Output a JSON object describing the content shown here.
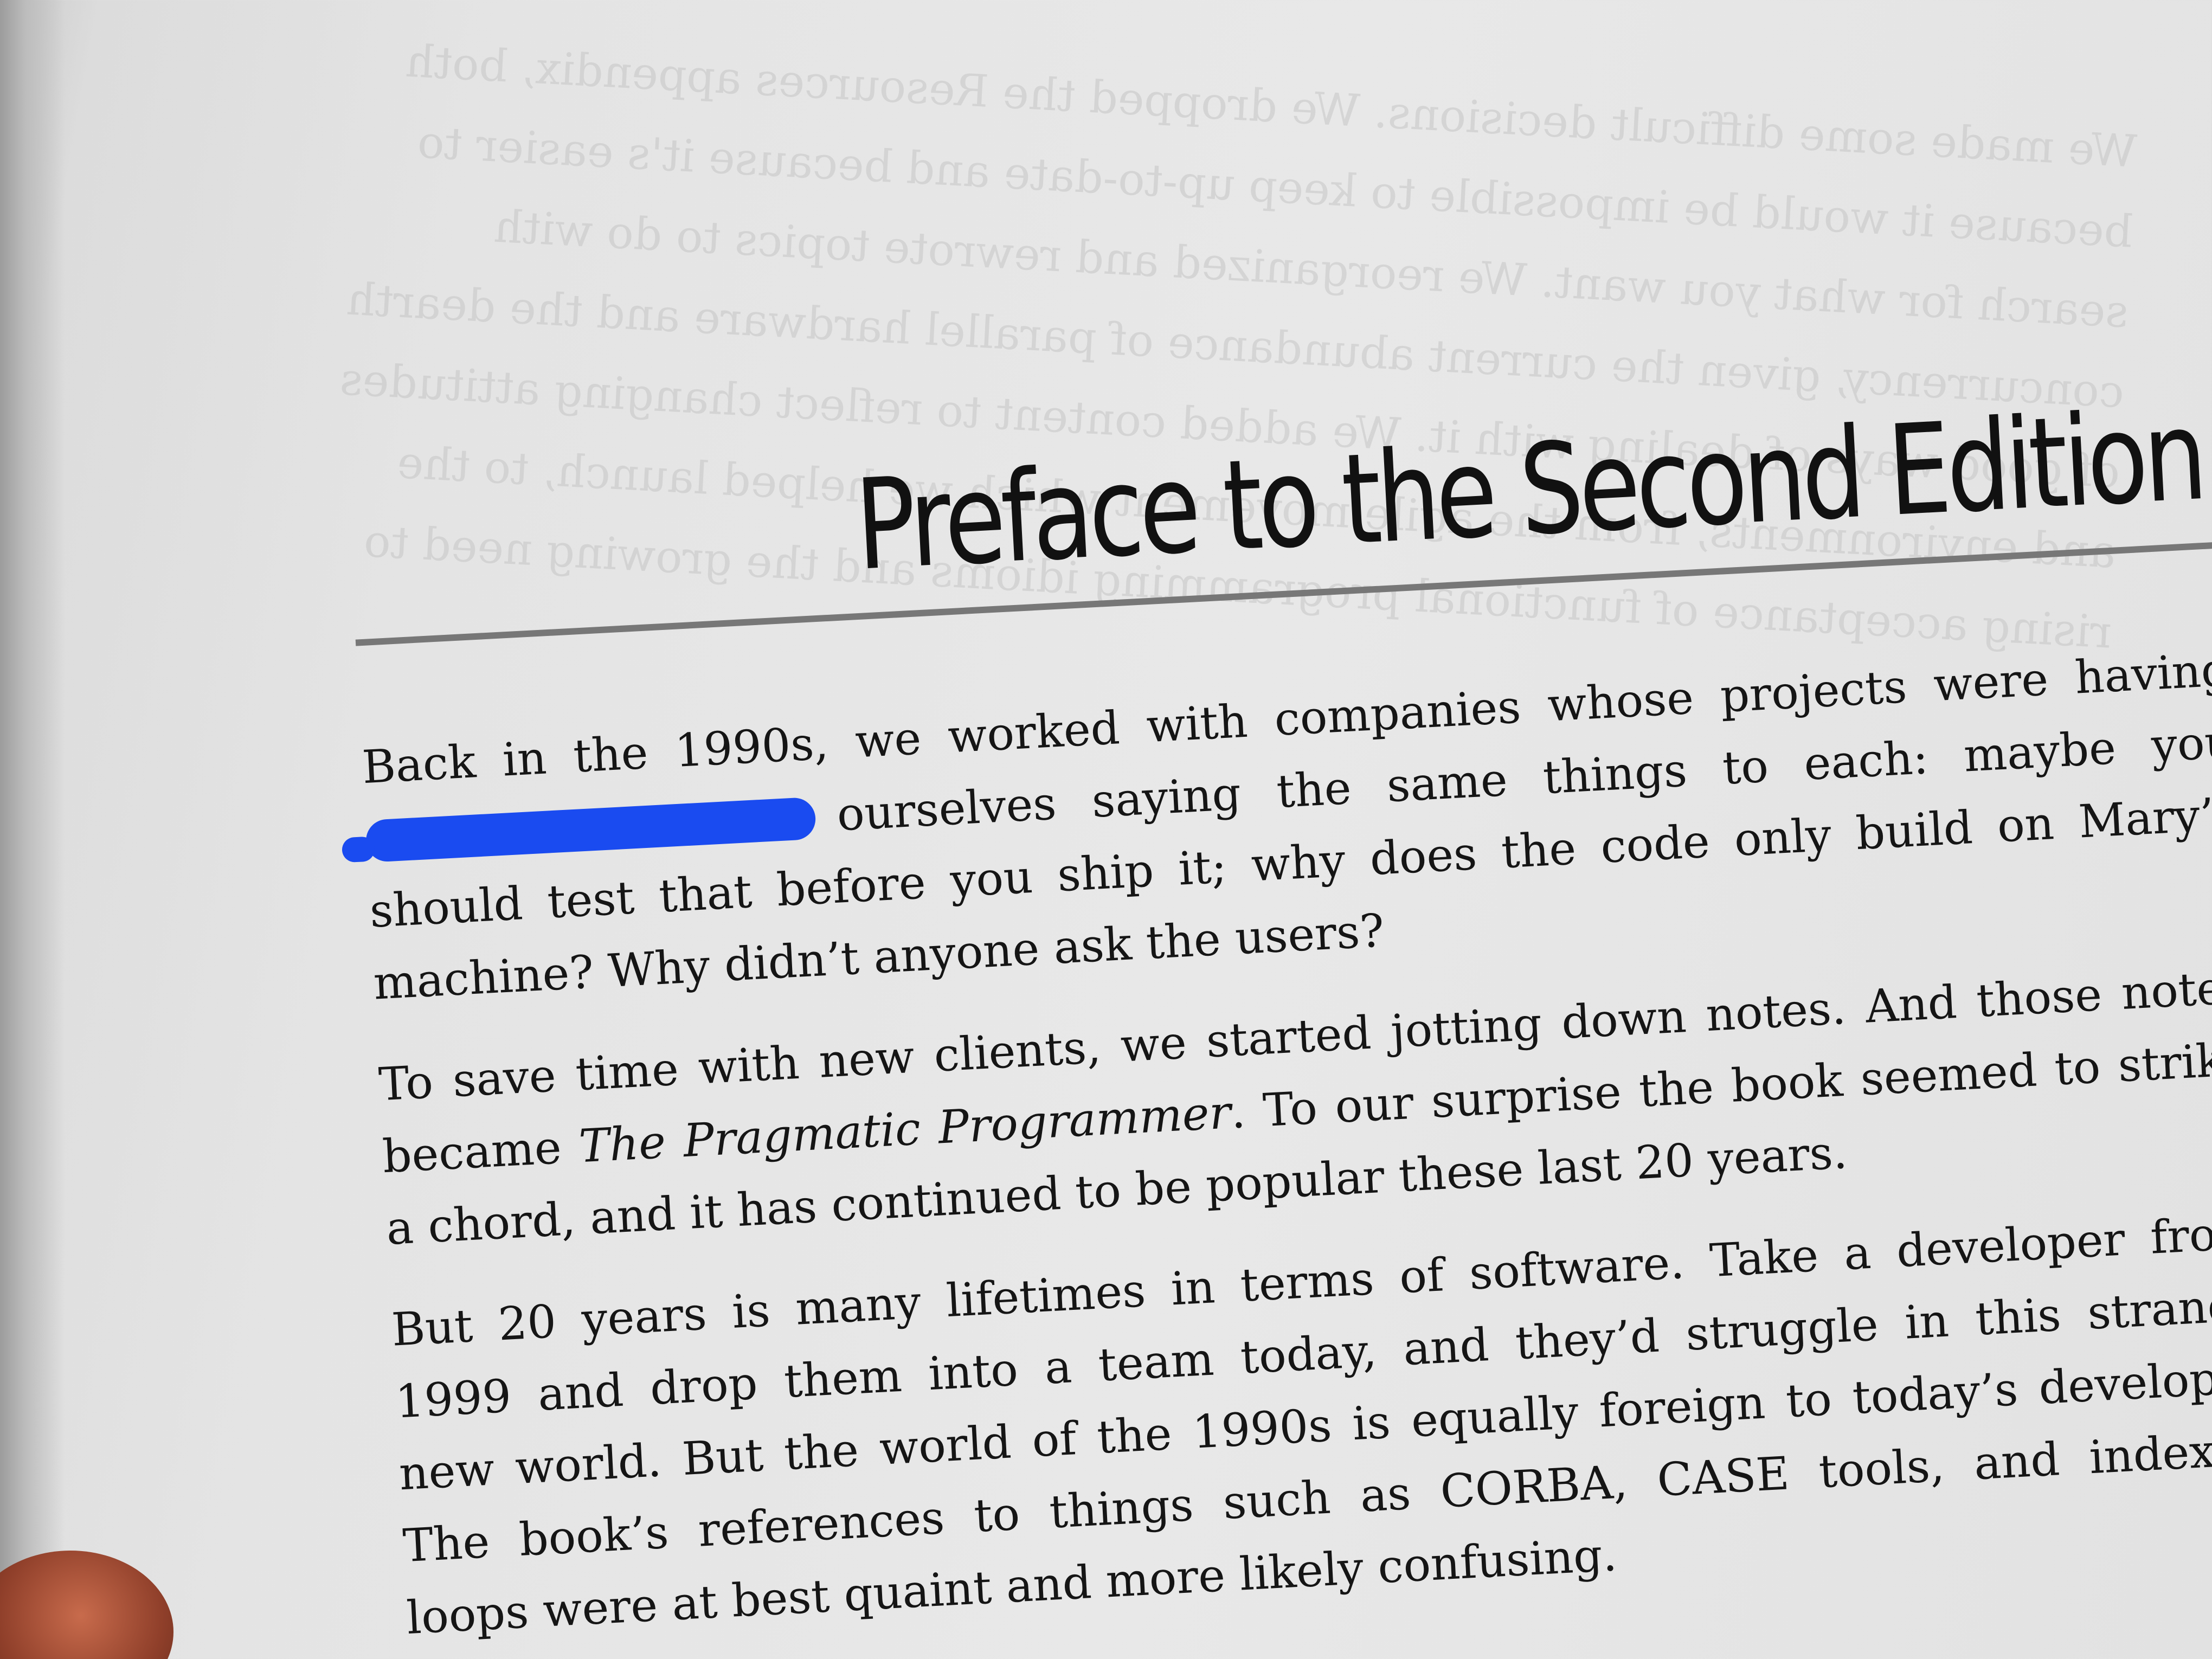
{
  "page": {
    "title": "Preface to the Second Edition",
    "paragraphs": [
      {
        "lines": [
          {
            "text": "Back in the 1990s, we worked with companies whose projects were having"
          },
          {
            "prefix": "",
            "text": "ourselves saying the same things to each: maybe you",
            "redacted": true
          },
          {
            "text": "should test that before you ship it; why does the code only build on Mary’s"
          },
          {
            "text": "machine? Why didn’t anyone ask the users?",
            "last": true
          }
        ]
      },
      {
        "lines": [
          {
            "text": "To save time with new clients, we started jotting down notes. And those notes"
          },
          {
            "before": "became ",
            "italic": "The Pragmatic Programmer",
            "after": ". To our surprise the book seemed to strike"
          },
          {
            "text": "a chord, and it has continued to be popular these last 20 years.",
            "last": true
          }
        ]
      },
      {
        "lines": [
          {
            "text": "But 20 years is many lifetimes in terms of software. Take a developer from"
          },
          {
            "text": "1999 and drop them into a team today, and they’d struggle in this strange"
          },
          {
            "text": "new world. But the world of the 1990s is equally foreign to today’s developer"
          },
          {
            "text": "The book’s references to things such as CORBA, CASE tools, and indexed"
          },
          {
            "text": "loops were at best quaint and more likely confusing.",
            "last": true
          }
        ]
      }
    ],
    "bleed_through": [
      "We made some difficult decisions. We dropped the Resources appendix, both",
      "because it would be impossible to keep up-to-date and because it's easier to",
      "search for what you want. We reorganized and rewrote topics to do with",
      "concurrency, given the current abundance of parallel hardware and the dearth",
      "of good ways of dealing with it. We added content to reflect changing attitudes",
      "and environments, from the agile movement which we helped launch, to the",
      "rising acceptance of functional programming idioms and the growing need to"
    ]
  }
}
